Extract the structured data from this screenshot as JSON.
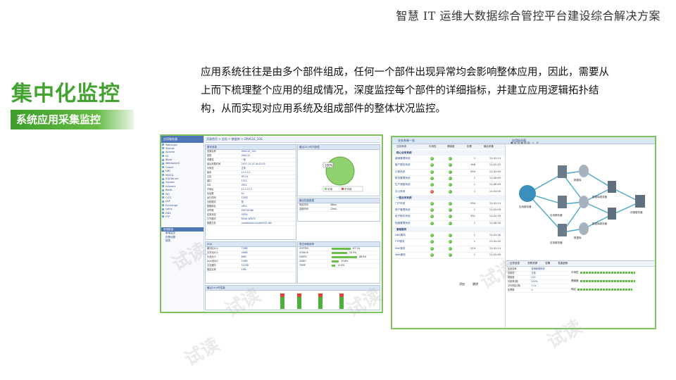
{
  "header": {
    "title": "智慧 IT 运维大数据综合管控平台建设综合解决方案"
  },
  "section": {
    "heading": "集中化监控",
    "subheading": "系统应用采集监控"
  },
  "paragraph": "应用系统往往是由多个部件组成，任何一个部件出现异常均会影响整体应用，因此，需要从上而下梳理整个应用的组成情况，深度监控每个部件的详细指标，并建立应用逻辑拓扑结构，从而实现对应用系统及组成部件的整体状况监控。",
  "watermark": "试读",
  "colors": {
    "accent_green": "#42a22f",
    "frame_green": "#7ec35f",
    "ok_green": "#2f9a19",
    "alert_red": "#c5281a"
  },
  "left_screenshot": {
    "sidebar": {
      "title": "应用服务器",
      "items": [
        "WebLogic",
        "Tomcat",
        "Apache",
        "IIS",
        "JBoss",
        "WebSphere",
        "Oracle",
        "DB2",
        "MySQL",
        "SQLServer",
        "Sybase",
        "Informix",
        "Redis",
        "MQ",
        "CICS",
        "SAP",
        "Exchange",
        "Lotus",
        "DNS",
        "FTP"
      ],
      "footer_title": "常用链接",
      "footer_items": [
        "新增监控",
        "告警设置",
        "报表"
      ]
    },
    "breadcrumb": "资源首页 > 应用 > 数据库 > ORACLE_10G",
    "info_panel": {
      "title": "基本信息",
      "rows": [
        {
          "k": "资源名称",
          "v": "ORACLE_10G"
        },
        {
          "k": "类型",
          "v": "ORACLE"
        },
        {
          "k": "重要性",
          "v": "一般"
        },
        {
          "k": "最后采集时间",
          "v": "2007-10-24 16:42:09"
        },
        {
          "k": "可用性",
          "v": "正常"
        },
        {
          "k": "版本",
          "v": "10.2.0.1"
        },
        {
          "k": "主机",
          "v": "HP-UX"
        },
        {
          "k": "端口",
          "v": "1521"
        },
        {
          "k": "SID",
          "v": "ORCL"
        },
        {
          "k": "IP地址",
          "v": "10.2.0.13"
        },
        {
          "k": "会话数",
          "v": "42"
        },
        {
          "k": "运行时间",
          "v": "128天"
        },
        {
          "k": "归档模式",
          "v": "是"
        },
        {
          "k": "数据库名",
          "v": "ORCL"
        },
        {
          "k": "字符集",
          "v": "ZHS16GBK"
        },
        {
          "k": "实例状态",
          "v": "OPEN"
        },
        {
          "k": "打开模式",
          "v": "READ WRITE"
        },
        {
          "k": "数据文件",
          "v": "/oradata/orcl/system01.dbf"
        }
      ]
    },
    "availability": {
      "title": "最近24小时可用性",
      "pie_label": "100%",
      "legend": [
        "可用",
        "不可用"
      ]
    },
    "perf": {
      "title": "最近性能数据",
      "rows": [
        {
          "k": "响应时间",
          "v": "48ms"
        },
        {
          "k": "连接时间",
          "v": "12ms"
        }
      ]
    },
    "sga": {
      "title": "SGA",
      "rows": [
        {
          "k": "缓冲区大小",
          "v": "72MB"
        },
        {
          "k": "共享池大小",
          "v": "48MB"
        },
        {
          "k": "大池大小",
          "v": "8MB"
        },
        {
          "k": "Java池大小",
          "v": "24MB"
        },
        {
          "k": "日志缓冲",
          "v": "512KB"
        },
        {
          "k": "固定区域",
          "v": "1MB"
        }
      ]
    },
    "tablespace": {
      "title": "表空间使用率",
      "rows": [
        {
          "k": "SYSTEM",
          "v": "67.1%",
          "pct": 0.67
        },
        {
          "k": "SYSAUX",
          "v": "54.3%",
          "pct": 0.54
        },
        {
          "k": "USERS",
          "v": "88.9%",
          "pct": 0.89
        },
        {
          "k": "UNDO",
          "v": "23.8%",
          "pct": 0.24
        },
        {
          "k": "TEMP",
          "v": "12.0%",
          "pct": 0.12
        }
      ]
    },
    "chart_title": "最近24小时性能"
  },
  "right_screenshot": {
    "list_title": "业务系统一览",
    "columns": [
      "业务系统",
      "可用性",
      "健康度",
      "告警",
      "最后采集"
    ],
    "groups": [
      {
        "name": "核心业务系统",
        "rows": [
          {
            "name": "营销管理系统",
            "status": "green",
            "count": "1",
            "time": "11:41:13"
          },
          {
            "name": "客户服务系统",
            "status": "green",
            "count": "168",
            "time": "11:41:13"
          },
          {
            "name": "计费系统",
            "status": "green",
            "count": "594",
            "time": "11:41:49"
          },
          {
            "name": "财务管理系统",
            "status": "green",
            "count": "1",
            "time": "11:40:49"
          },
          {
            "name": "生产调度系统",
            "status": "green",
            "count": "1",
            "time": "11:40:49"
          },
          {
            "name": "办公系统",
            "status": "red",
            "count": "1",
            "time": "11:41:00"
          }
        ]
      },
      {
        "name": "一般业务系统",
        "rows": [
          {
            "name": "门户系统",
            "status": "green",
            "count": "594",
            "time": "11:41:13"
          },
          {
            "name": "资产管理系统",
            "status": "green",
            "count": "1",
            "time": "11:41:09"
          },
          {
            "name": "电子邮件系统",
            "status": "green",
            "count": "531",
            "time": "11:41:19"
          },
          {
            "name": "档案管理系统",
            "status": "green",
            "count": "1",
            "time": "11:40:35"
          }
        ]
      },
      {
        "name": "基础服务",
        "rows": [
          {
            "name": "DNS服务",
            "status": "green",
            "count": "1",
            "time": "11:41:16"
          },
          {
            "name": "FTP服务",
            "status": "green",
            "count": "1",
            "time": "11:41:20"
          },
          {
            "name": "Mail服务",
            "status": "green",
            "count": "219",
            "time": "11:41:13"
          },
          {
            "name": "Web服务",
            "status": "green",
            "count": "1",
            "time": "11:41:49"
          }
        ]
      }
    ],
    "list_buttons": [
      "添加",
      "删除"
    ],
    "topology": {
      "title": "应用拓扑图",
      "labels": [
        "应用服务器",
        "数据库",
        "应用服务器",
        "数据库服务器",
        "应用服务器",
        "数据库",
        "数据库服务器",
        "存储服务器"
      ]
    },
    "detail": {
      "tabs": [
        "业务信息",
        "关联资源",
        "告警",
        "性能趋势"
      ],
      "rows": [
        {
          "k": "业务名称",
          "v": "营销管理系统"
        },
        {
          "k": "可用性",
          "v": "正常"
        },
        {
          "k": "健康度",
          "v": "100"
        },
        {
          "k": "可用率(周)",
          "v": "100%"
        },
        {
          "k": "平均响应(周)",
          "v": "1.2s"
        },
        {
          "k": "告警数",
          "v": "0"
        }
      ],
      "bar_labels": [
        "可用性",
        "健康度",
        "响应"
      ]
    }
  }
}
